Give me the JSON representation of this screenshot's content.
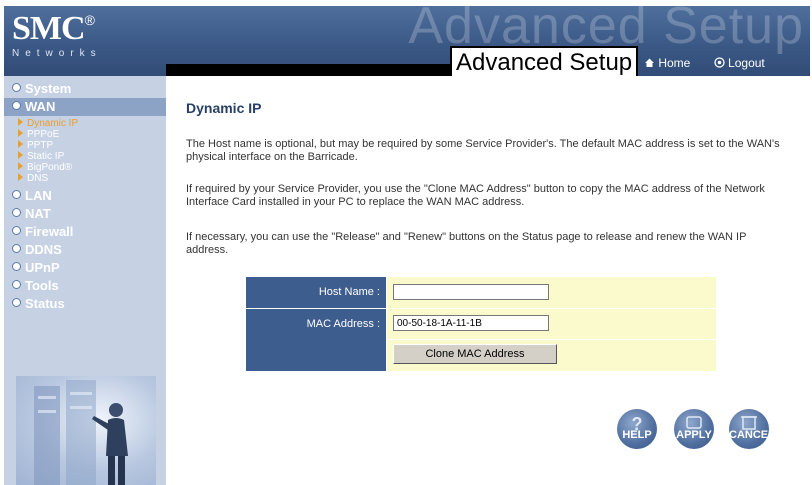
{
  "header": {
    "logo": "SMC",
    "logo_reg": "®",
    "logo_sub": "Networks",
    "watermark": "Advanced Setup",
    "title": "Advanced Setup",
    "home_label": "Home",
    "logout_label": "Logout"
  },
  "sidebar": {
    "items": [
      {
        "label": "System"
      },
      {
        "label": "WAN",
        "active": true
      },
      {
        "label": "LAN"
      },
      {
        "label": "NAT"
      },
      {
        "label": "Firewall"
      },
      {
        "label": "DDNS"
      },
      {
        "label": "UPnP"
      },
      {
        "label": "Tools"
      },
      {
        "label": "Status"
      }
    ],
    "wan_subitems": [
      {
        "label": "Dynamic IP",
        "active": true
      },
      {
        "label": "PPPoE"
      },
      {
        "label": "PPTP"
      },
      {
        "label": "Static IP"
      },
      {
        "label": "BigPond®"
      },
      {
        "label": "DNS"
      }
    ]
  },
  "main": {
    "title": "Dynamic IP",
    "para1": "The Host name is optional, but may be required by some Service Provider's. The default MAC address is set to the WAN's physical interface on the Barricade.",
    "para2": "If required by your Service Provider, you use the \"Clone MAC Address\" button to copy the MAC address of the Network Interface Card installed in your PC to replace the WAN MAC address.",
    "para3": "If necessary, you can use the \"Release\" and \"Renew\" buttons on the Status page to release and renew the WAN IP address."
  },
  "form": {
    "host_label": "Host Name :",
    "host_value": "",
    "mac_label": "MAC Address :",
    "mac_value": "00-50-18-1A-11-1B",
    "clone_label": "Clone MAC Address"
  },
  "actions": {
    "help": "HELP",
    "apply": "APPLY",
    "cancel": "CANCEL"
  },
  "colors": {
    "header_bg": "#3a5784",
    "sidebar_bg": "#c6d2e4",
    "label_cell": "#3d5d8e",
    "input_cell": "#fafacc",
    "title_text": "#284068",
    "active_sub": "#e8a030"
  }
}
